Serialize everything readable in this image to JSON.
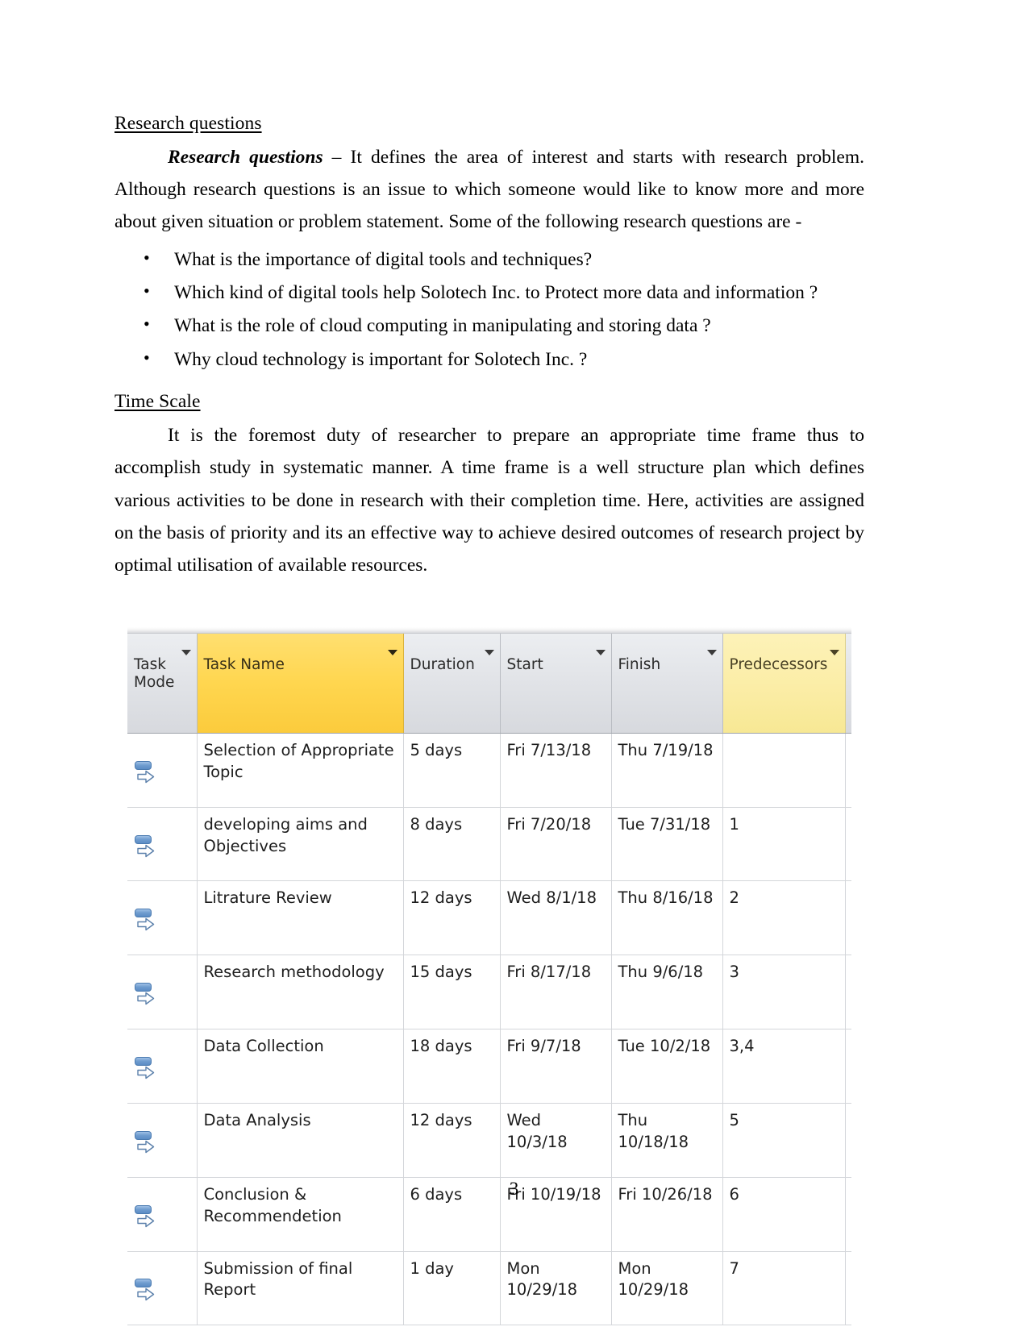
{
  "document": {
    "page_number": "3",
    "sections": {
      "research_questions": {
        "heading": "Research questions",
        "intro_lead": "Research questions",
        "intro_rest": " – It defines the area of interest and starts with research problem. Although research questions is an issue to which someone would like to know more and more about given situation or problem statement. Some of the following research questions are -",
        "bullets": [
          "What is the importance of digital tools and techniques?",
          "Which kind of  digital tools help Solotech Inc. to Protect more data and information ?",
          "What is the role of cloud computing in manipulating and storing data ?",
          "Why cloud technology is important for Solotech Inc. ?"
        ]
      },
      "time_scale": {
        "heading": "Time Scale",
        "paragraph": "It is the foremost duty of researcher to prepare an appropriate time frame thus to accomplish study in systematic manner. A time frame is a well structure plan which defines various activities to be done in research with their completion time. Here, activities are assigned on the basis of priority and its an effective way to achieve desired outcomes of research project by optimal utilisation of available resources."
      }
    }
  },
  "project_table": {
    "columns": [
      {
        "key": "task_mode",
        "label": "Task\nMode",
        "style": "normal",
        "filter": true
      },
      {
        "key": "task_name",
        "label": "Task Name",
        "style": "selected",
        "filter": true
      },
      {
        "key": "duration",
        "label": "Duration",
        "style": "normal",
        "filter": true
      },
      {
        "key": "start",
        "label": "Start",
        "style": "normal",
        "filter": true
      },
      {
        "key": "finish",
        "label": "Finish",
        "style": "normal",
        "filter": true
      },
      {
        "key": "predecessors",
        "label": "Predecessors",
        "style": "soft",
        "filter": true
      }
    ],
    "rows": [
      {
        "mode_icon": "auto-schedule-icon",
        "task_name": "Selection of Appropriate\nTopic",
        "duration": "5 days",
        "start": "Fri 7/13/18",
        "finish": "Thu 7/19/18",
        "predecessors": ""
      },
      {
        "mode_icon": "auto-schedule-icon",
        "task_name": "developing aims and\nObjectives",
        "duration": "8 days",
        "start": "Fri 7/20/18",
        "finish": "Tue 7/31/18",
        "predecessors": "1"
      },
      {
        "mode_icon": "auto-schedule-icon",
        "task_name": "Litrature Review",
        "duration": "12 days",
        "start": "Wed 8/1/18",
        "finish": "Thu 8/16/18",
        "predecessors": "2"
      },
      {
        "mode_icon": "auto-schedule-icon",
        "task_name": "Research methodology",
        "duration": "15 days",
        "start": "Fri 8/17/18",
        "finish": "Thu 9/6/18",
        "predecessors": "3"
      },
      {
        "mode_icon": "auto-schedule-icon",
        "task_name": "Data Collection",
        "duration": "18 days",
        "start": "Fri 9/7/18",
        "finish": "Tue 10/2/18",
        "predecessors": "3,4"
      },
      {
        "mode_icon": "auto-schedule-icon",
        "task_name": "Data Analysis",
        "duration": "12 days",
        "start": "Wed 10/3/18",
        "finish": "Thu 10/18/18",
        "predecessors": "5"
      },
      {
        "mode_icon": "auto-schedule-icon",
        "task_name": "Conclusion &\nRecommendetion",
        "duration": "6 days",
        "start": "Fri 10/19/18",
        "finish": "Fri 10/26/18",
        "predecessors": "6"
      },
      {
        "mode_icon": "auto-schedule-icon",
        "task_name": "Submission of final\nReport",
        "duration": "1 day",
        "start": "Mon 10/29/18",
        "finish": "Mon 10/29/18",
        "predecessors": "7"
      }
    ],
    "colors": {
      "header_default": "#e2e4e8",
      "header_selected": "#ffd64f",
      "header_soft": "#fbeda6",
      "grid_line": "#d4d6da",
      "icon_blue": "#6f9ccf"
    }
  }
}
